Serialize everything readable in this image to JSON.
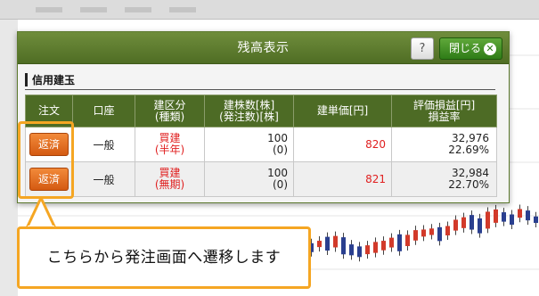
{
  "modal": {
    "title": "残高表示",
    "help_label": "?",
    "close_label": "閉じる",
    "close_icon": "close-circle-icon"
  },
  "section": {
    "title": "信用建玉"
  },
  "table": {
    "headers": {
      "order": "注文",
      "account": "口座",
      "type_line1": "建区分",
      "type_line2": "(種類)",
      "qty_line1": "建株数[株]",
      "qty_line2": "(発注数)[株]",
      "price": "建単価[円]",
      "pl_line1": "評価損益[円]",
      "pl_line2": "損益率"
    },
    "rows": [
      {
        "button": "返済",
        "account": "一般",
        "type": "買建",
        "term": "(半年)",
        "qty": "100",
        "pending": "(0)",
        "price": "820",
        "pl": "32,976",
        "rate": "22.69%"
      },
      {
        "button": "返済",
        "account": "一般",
        "type": "買建",
        "term": "(無期)",
        "qty": "100",
        "pending": "(0)",
        "price": "821",
        "pl": "32,984",
        "rate": "22.70%"
      }
    ]
  },
  "callout": {
    "text": "こちらから発注画面へ遷移します"
  },
  "colors": {
    "header_green": "#4d6b25",
    "close_green": "#2f7c17",
    "repay_orange": "#e06a1f",
    "highlight": "#f5a623",
    "red_text": "#e02020"
  }
}
